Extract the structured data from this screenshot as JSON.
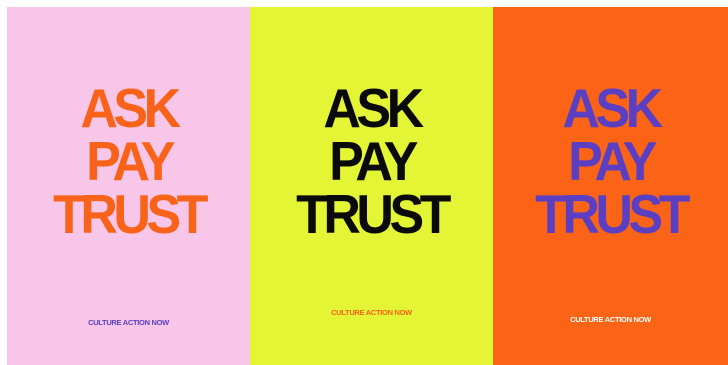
{
  "posters": [
    {
      "lines": [
        "ASK",
        "PAY",
        "TRUST"
      ],
      "footer": "CULTURE ACTION NOW",
      "colors": {
        "background": "#f8c6e8",
        "headline": "#f96319",
        "footer": "#5a3fc2"
      }
    },
    {
      "lines": [
        "ASK",
        "PAY",
        "TRUST"
      ],
      "footer": "CULTURE ACTION NOW",
      "colors": {
        "background": "#e3f534",
        "headline": "#0a0a0a",
        "footer": "#f96319"
      }
    },
    {
      "lines": [
        "ASK",
        "PAY",
        "TRUST"
      ],
      "footer": "CULTURE ACTION NOW",
      "colors": {
        "background": "#fb6416",
        "headline": "#5a3fc2",
        "footer": "#ffffff"
      }
    }
  ]
}
